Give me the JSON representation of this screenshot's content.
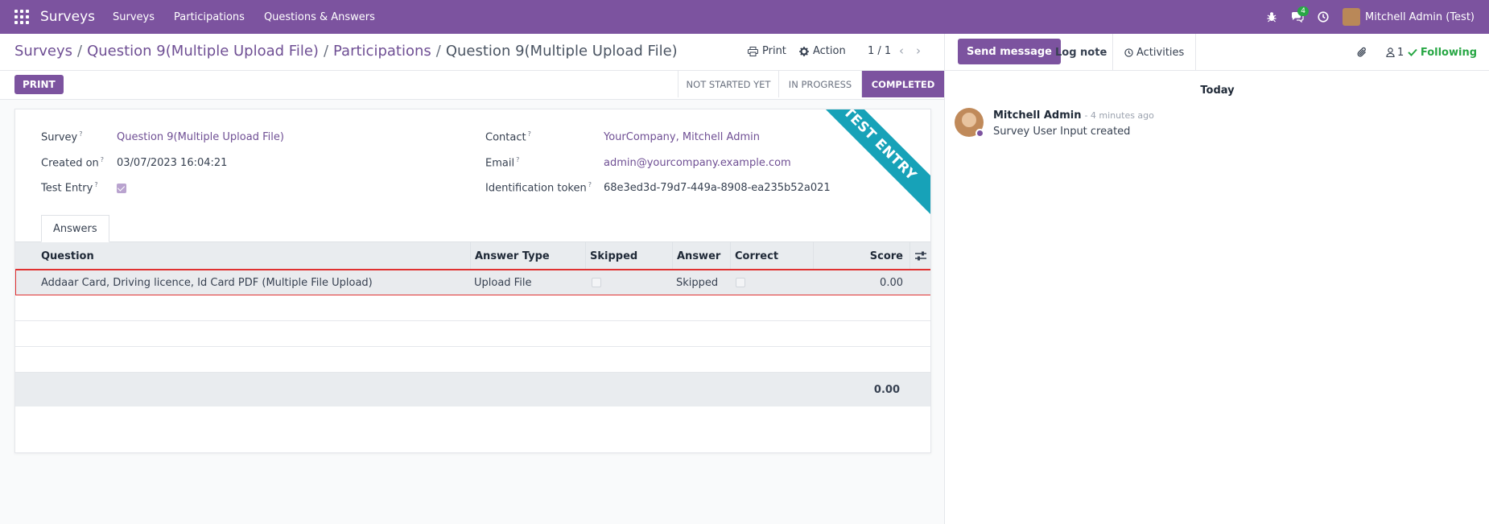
{
  "navbar": {
    "brand": "Surveys",
    "menu": [
      "Surveys",
      "Participations",
      "Questions & Answers"
    ],
    "messages_badge": "4",
    "user_name": "Mitchell Admin (Test)",
    "color": "#7c539f"
  },
  "breadcrumb": {
    "items": [
      "Surveys",
      "Question 9(Multiple Upload File)",
      "Participations"
    ],
    "current": "Question 9(Multiple Upload File)"
  },
  "actions": {
    "print": "Print",
    "action": "Action",
    "pager": "1 / 1"
  },
  "statusbar": {
    "print_button": "PRINT",
    "stages": [
      "NOT STARTED YET",
      "IN PROGRESS",
      "COMPLETED"
    ],
    "active_stage": "COMPLETED"
  },
  "form": {
    "ribbon": "TEST ENTRY",
    "survey_label": "Survey",
    "survey_value": "Question 9(Multiple Upload File)",
    "created_label": "Created on",
    "created_value": "03/07/2023 16:04:21",
    "test_label": "Test Entry",
    "test_checked": true,
    "contact_label": "Contact",
    "contact_value": "YourCompany, Mitchell Admin",
    "email_label": "Email",
    "email_value": "admin@yourcompany.example.com",
    "token_label": "Identification token",
    "token_value": "68e3ed3d-79d7-449a-8908-ea235b52a021",
    "help_mark": "?"
  },
  "answers": {
    "tab_label": "Answers",
    "columns": [
      "Question",
      "Answer Type",
      "Skipped",
      "Answer",
      "Correct",
      "Score"
    ],
    "rows": [
      {
        "question": "Addaar Card, Driving licence, Id Card PDF (Multiple File Upload)",
        "answer_type": "Upload File",
        "skipped": false,
        "answer": "Skipped",
        "correct": false,
        "score": "0.00"
      }
    ],
    "total": "0.00"
  },
  "chatter": {
    "send_message": "Send message",
    "log_note": "Log note",
    "activities": "Activities",
    "followers_count": "1",
    "following": "Following",
    "date_separator": "Today",
    "message": {
      "author": "Mitchell Admin",
      "time": "- 4 minutes ago",
      "body": "Survey User Input created"
    }
  },
  "icons": [
    "apps-icon",
    "bug-icon",
    "chat-icon",
    "clock-icon",
    "print-icon",
    "gear-icon",
    "chevron-left-icon",
    "chevron-right-icon",
    "settings-sliders-icon",
    "paperclip-icon",
    "user-icon",
    "check-icon"
  ]
}
